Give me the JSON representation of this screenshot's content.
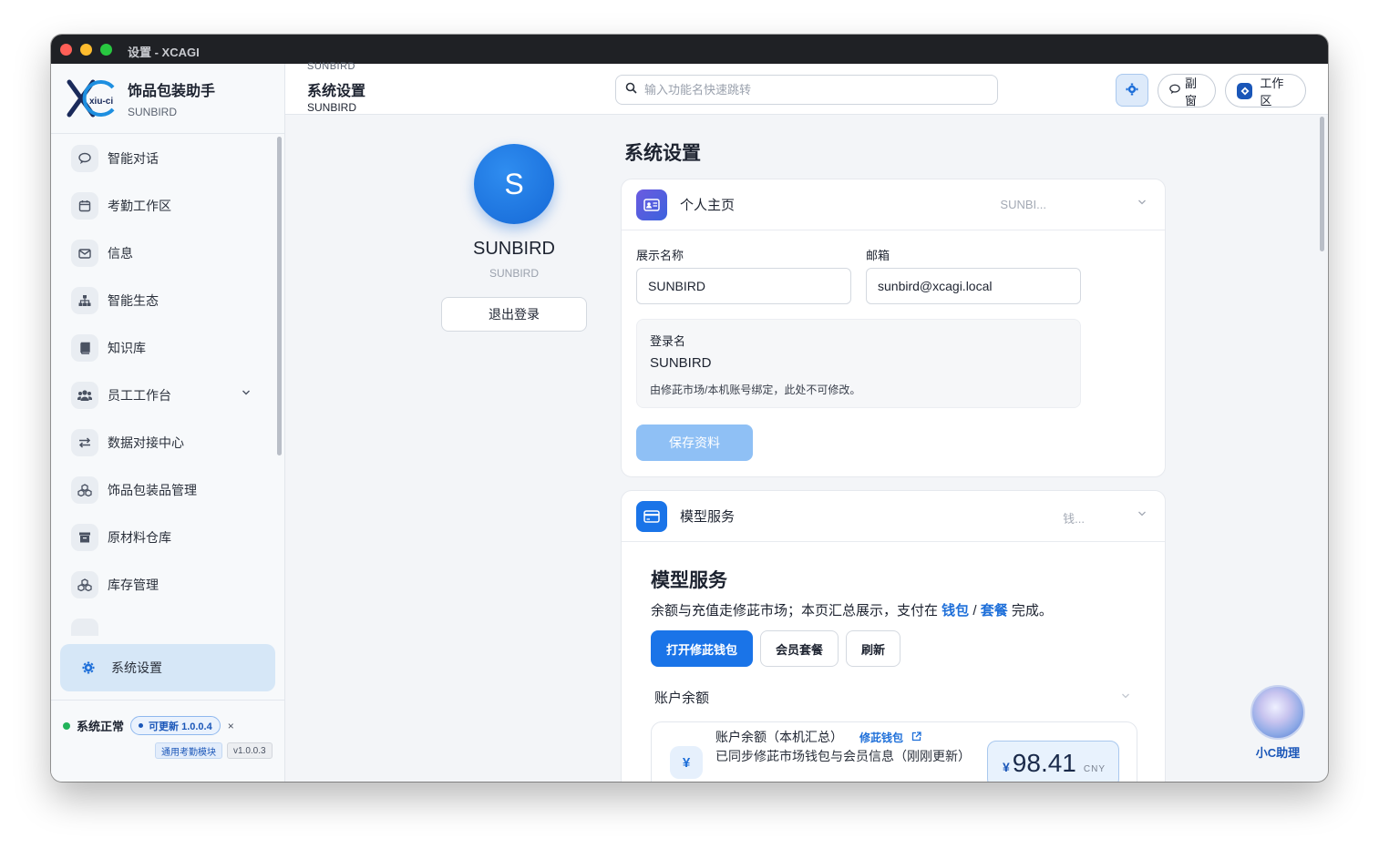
{
  "window": {
    "title": "设置 - XCAGI"
  },
  "brand": {
    "name": "饰品包装助手",
    "sub": "SUNBIRD",
    "logo_text": "xiu-ci"
  },
  "nav": [
    {
      "label": "智能对话",
      "icon": "chat-icon"
    },
    {
      "label": "考勤工作区",
      "icon": "calendar-icon"
    },
    {
      "label": "信息",
      "icon": "mail-icon"
    },
    {
      "label": "智能生态",
      "icon": "sitemap-icon"
    },
    {
      "label": "知识库",
      "icon": "book-icon"
    },
    {
      "label": "员工工作台",
      "icon": "users-icon"
    },
    {
      "label": "数据对接中心",
      "icon": "exchange-icon"
    },
    {
      "label": "饰品包装品管理",
      "icon": "cubes-icon"
    },
    {
      "label": "原材料仓库",
      "icon": "archive-icon"
    },
    {
      "label": "库存管理",
      "icon": "cubes-icon"
    }
  ],
  "nav_active": {
    "label": "系统设置",
    "icon": "gear-icon"
  },
  "footer": {
    "status": "系统正常",
    "update": "可更新 1.0.0.4",
    "close": "×",
    "tag_module": "通用考勤模块",
    "tag_version": "v1.0.0.3"
  },
  "topbar": {
    "crumb_top": "SUNBIRD",
    "title": "系统设置",
    "sub": "SUNBIRD",
    "search_placeholder": "输入功能名快速跳转",
    "btn_subwindow": "副窗",
    "btn_workspace": "工作区"
  },
  "profile": {
    "initial": "S",
    "name": "SUNBIRD",
    "sub": "SUNBIRD",
    "logout": "退出登录"
  },
  "page_title": "系统设置",
  "personal_card": {
    "title": "个人主页",
    "meta": "SUNBI...",
    "display_name_label": "展示名称",
    "display_name_value": "SUNBIRD",
    "email_label": "邮箱",
    "email_value": "sunbird@xcagi.local",
    "login_label": "登录名",
    "login_value": "SUNBIRD",
    "login_note": "由修茈市场/本机账号绑定，此处不可修改。",
    "save": "保存资料"
  },
  "model_card": {
    "title": "模型服务",
    "meta": "钱...",
    "heading": "模型服务",
    "desc_pre": "余额与充值走修茈市场；本页汇总展示，支付在 ",
    "desc_link1": "钱包",
    "desc_sep": " / ",
    "desc_link2": "套餐",
    "desc_post": " 完成。",
    "btn_wallet": "打开修茈钱包",
    "btn_plan": "会员套餐",
    "btn_refresh": "刷新",
    "balance_section": "账户余额",
    "balance_title": "账户余额（本机汇总）",
    "balance_link": "修茈钱包",
    "balance_note": "已同步修茈市场钱包与会员信息（刚刚更新）",
    "currency_symbol": "¥",
    "amount": "98.41",
    "currency": "CNY"
  },
  "assistant": {
    "label": "小C助理"
  },
  "colors": {
    "accent": "#1a74e8",
    "status_ok": "#22b35a",
    "active_bg": "#d6e7f7"
  }
}
